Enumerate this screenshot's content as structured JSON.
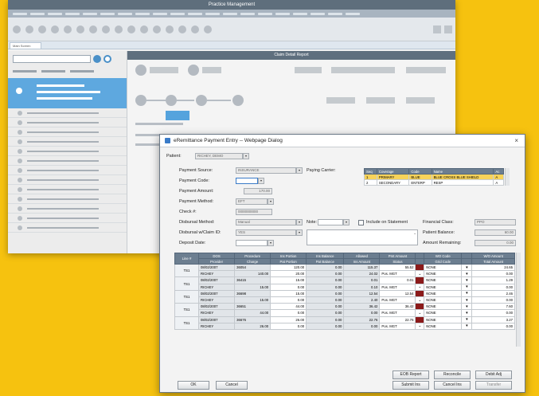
{
  "bg": {
    "title": "Practice Management",
    "tab": "Main Screen",
    "main_header": "Claim Detail Report"
  },
  "dialog": {
    "title": "eRemittance Payment Entry -- Webpage Dialog",
    "close": "×",
    "patient_label": "Patient:",
    "patient_value": "RICHEY, DEMO",
    "fields": {
      "payment_source_label": "Payment Source:",
      "payment_source_value": "INSURANCE",
      "payment_code_label": "Payment Code:",
      "payment_code_value": "",
      "payment_amount_label": "Payment Amount:",
      "payment_amount_value": "170.00",
      "payment_method_label": "Payment Method:",
      "payment_method_value": "EFT",
      "check_label": "Check #:",
      "check_value": "0000000000",
      "disbursal_method_label": "Disbursal Method:",
      "disbursal_method_value": "Manual",
      "disbursal_claim_label": "Disbursal w/Claim ID:",
      "disbursal_claim_value": "YES",
      "deposit_date_label": "Deposit Date:",
      "deposit_date_value": "",
      "paying_carrier_label": "Paying Carrier:",
      "note_label": "Note:",
      "include_statement_label": "Include on Statement",
      "financial_class_label": "Financial Class:",
      "financial_class_value": "PPO",
      "patient_balance_label": "Patient Balance:",
      "patient_balance_value": "60.00",
      "amount_remaining_label": "Amount Remaining:",
      "amount_remaining_value": "0.00"
    },
    "carrier_table": {
      "headers": [
        "Seq",
        "Coverage",
        "Code",
        "Name",
        "Ac"
      ],
      "rows": [
        {
          "seq": "1",
          "coverage": "PRIMARY",
          "code": "BLUE",
          "name": "BLUE CROSS BLUE SHIELD",
          "ac": "A"
        },
        {
          "seq": "2",
          "coverage": "SECONDARY",
          "code": "ENTERP",
          "name": "RESP",
          "ac": "A"
        }
      ]
    },
    "grid": {
      "headers_top": [
        "Line #",
        "DOS",
        "Procedure",
        "Ins Portion",
        "Ins Balance",
        "Allowed",
        "Pmt Amount",
        "",
        "WO Code",
        "",
        "W/O Amount"
      ],
      "headers_bottom": [
        "",
        "Provider",
        "Charge",
        "Pat Portion",
        "Pat Balance",
        "Ins Amount",
        "Status",
        "",
        "Grid Code",
        "",
        "Total Amount"
      ],
      "lines": [
        {
          "line": "TS1",
          "dos": "08/02/2007",
          "proc": "36054",
          "ins_portion": "120.00",
          "ins_bal": "0.00",
          "allowed": "115.37",
          "pmt": "55.52",
          "wo": "NONE",
          "wo_amt": "24.65",
          "provider": "RICHEY",
          "charge": "140.00",
          "pat_portion": "20.00",
          "pat_bal": "0.00",
          "ins_amt": "24.02",
          "status": "Pos. MGT",
          "grid": "NONE",
          "total": "0.00"
        },
        {
          "line": "TS1",
          "dos": "08/02/2007",
          "proc": "36415",
          "ins_portion": "15.00",
          "ins_bal": "0.00",
          "allowed": "0.01",
          "pmt": "0.01",
          "wo": "NONE",
          "wo_amt": "1.29",
          "provider": "RICHEY",
          "charge": "15.00",
          "pat_portion": "0.00",
          "pat_bal": "0.00",
          "ins_amt": "0.10",
          "status": "Pos. MGT",
          "grid": "NONE",
          "total": "0.00"
        },
        {
          "line": "TS1",
          "dos": "08/02/2007",
          "proc": "36698",
          "ins_portion": "15.00",
          "ins_bal": "0.00",
          "allowed": "12.54",
          "pmt": "12.54",
          "wo": "NONE",
          "wo_amt": "2.46",
          "provider": "RICHEY",
          "charge": "15.00",
          "pat_portion": "0.00",
          "pat_bal": "0.00",
          "ins_amt": "2.40",
          "status": "Pos. MGT",
          "grid": "NONE",
          "total": "0.00"
        },
        {
          "line": "TS1",
          "dos": "08/02/2007",
          "proc": "36651",
          "ins_portion": "44.00",
          "ins_bal": "0.00",
          "allowed": "36.42",
          "pmt": "36.42",
          "wo": "NONE",
          "wo_amt": "7.60",
          "provider": "RICHEY",
          "charge": "44.00",
          "pat_portion": "0.00",
          "pat_bal": "0.00",
          "ins_amt": "0.00",
          "status": "Pos. MGT",
          "grid": "NONE",
          "total": "0.00"
        },
        {
          "line": "TS1",
          "dos": "08/02/2007",
          "proc": "36676",
          "ins_portion": "26.00",
          "ins_bal": "0.00",
          "allowed": "22.76",
          "pmt": "22.76",
          "wo": "NONE",
          "wo_amt": "3.27",
          "provider": "RICHEY",
          "charge": "26.00",
          "pat_portion": "0.00",
          "pat_bal": "0.00",
          "ins_amt": "0.00",
          "status": "Pos. MGT",
          "grid": "NONE",
          "total": "0.00"
        }
      ]
    },
    "buttons": {
      "eob_report": "EOB Report",
      "reconcile": "Reconcile",
      "debit_adj": "Debit Adj",
      "submit_ins": "Submit Ins",
      "cancel_ins": "Cancel Ins",
      "transfer": "Transfer",
      "ok": "OK",
      "cancel": "Cancel"
    }
  },
  "colors": {
    "background": "#f6c20f",
    "accent_blue": "#5ea8df",
    "grid_header": "#6c7e90",
    "selected_row": "#f7d35a"
  }
}
